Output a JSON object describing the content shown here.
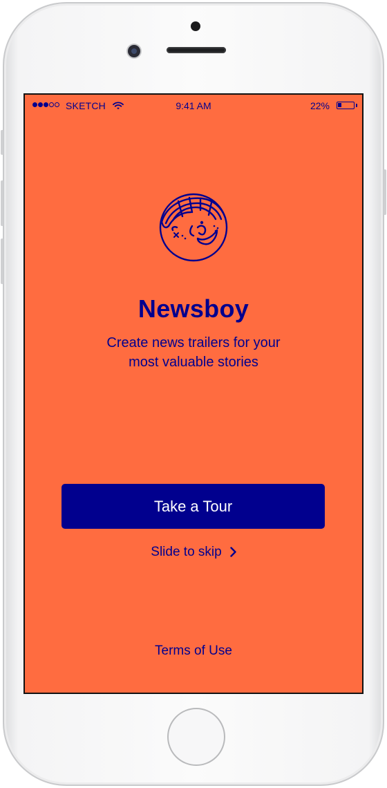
{
  "status_bar": {
    "carrier": "SKETCH",
    "time": "9:41 AM",
    "battery_percent": "22%",
    "battery_level": 0.22,
    "signal_bars_filled": 3,
    "signal_bars_total": 5
  },
  "app": {
    "title": "Newsboy",
    "subtitle_line1": "Create news trailers for your",
    "subtitle_line2": "most valuable stories",
    "cta_label": "Take a Tour",
    "skip_label": "Slide to skip",
    "terms_label": "Terms of Use"
  },
  "colors": {
    "background": "#ff6c40",
    "accent": "#01008e",
    "button_text": "#ffffff"
  },
  "icons": [
    "wifi-icon",
    "battery-icon",
    "newsboy-face-icon",
    "chevron-right-icon"
  ]
}
